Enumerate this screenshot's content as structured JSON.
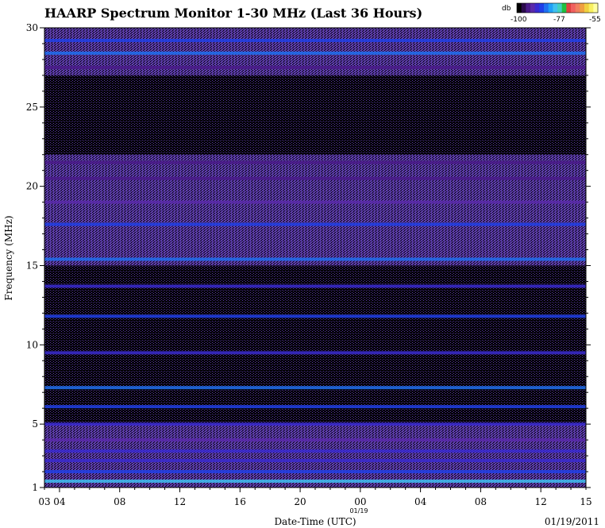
{
  "chart_data": {
    "type": "heatmap",
    "title": "HAARP Spectrum Monitor 1-30 MHz (Last 36 Hours)",
    "xlabel": "Date-Time (UTC)",
    "ylabel": "Frequency (MHz)",
    "date_label": "01/19/2011",
    "date_marker": "01/19",
    "x_ticks": [
      "03",
      "04",
      "08",
      "12",
      "16",
      "20",
      "00",
      "04",
      "08",
      "12",
      "15"
    ],
    "y_ticks": [
      1,
      5,
      10,
      15,
      20,
      25,
      30
    ],
    "ylim": [
      1,
      30
    ],
    "grid": false,
    "colorbar": {
      "unit": "db",
      "range": [
        -100,
        -55
      ],
      "tick_labels": [
        "-100",
        "-77",
        "-55"
      ],
      "colors": [
        "#000000",
        "#2a0a4a",
        "#4a1a8a",
        "#5a2aaa",
        "#3a2ad0",
        "#2040e8",
        "#2070f0",
        "#20a0f8",
        "#40c0f0",
        "#40d0c0",
        "#20c040",
        "#e04040",
        "#f06060",
        "#f08060",
        "#f0a040",
        "#f0d040",
        "#f8f060",
        "#ffffa0"
      ],
      "legend_position": "top-right"
    },
    "bands": [
      {
        "freq_mhz": 1.4,
        "level_db": -80
      },
      {
        "freq_mhz": 2.0,
        "level_db": -86
      },
      {
        "freq_mhz": 2.7,
        "level_db": -88
      },
      {
        "freq_mhz": 3.3,
        "level_db": -90
      },
      {
        "freq_mhz": 4.0,
        "level_db": -92
      },
      {
        "freq_mhz": 5.0,
        "level_db": -90
      },
      {
        "freq_mhz": 6.1,
        "level_db": -86
      },
      {
        "freq_mhz": 7.3,
        "level_db": -85
      },
      {
        "freq_mhz": 9.5,
        "level_db": -88
      },
      {
        "freq_mhz": 11.8,
        "level_db": -86
      },
      {
        "freq_mhz": 13.7,
        "level_db": -88
      },
      {
        "freq_mhz": 15.4,
        "level_db": -84
      },
      {
        "freq_mhz": 17.6,
        "level_db": -86
      },
      {
        "freq_mhz": 19.0,
        "level_db": -92
      },
      {
        "freq_mhz": 20.5,
        "level_db": -93
      },
      {
        "freq_mhz": 21.5,
        "level_db": -94
      },
      {
        "freq_mhz": 27.5,
        "level_db": -93
      },
      {
        "freq_mhz": 28.4,
        "level_db": -84
      },
      {
        "freq_mhz": 29.2,
        "level_db": -86
      }
    ]
  }
}
